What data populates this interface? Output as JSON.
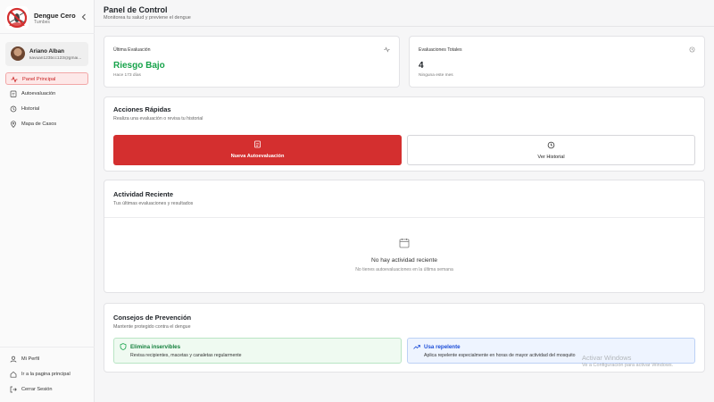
{
  "brand": {
    "title": "Dengue Cero",
    "subtitle": "Tumbes",
    "logo_icon": "no-mosquito-icon",
    "collapse_icon": "chevron-left-icon"
  },
  "user": {
    "name": "Ariano Alban",
    "email": "kavuan123bcc123@gmai..."
  },
  "nav": {
    "items": [
      {
        "label": "Panel Principal",
        "icon": "activity-icon",
        "active": true
      },
      {
        "label": "Autoevaluación",
        "icon": "clipboard-icon",
        "active": false
      },
      {
        "label": "Historial",
        "icon": "history-icon",
        "active": false
      },
      {
        "label": "Mapa de Casos",
        "icon": "map-pin-icon",
        "active": false
      }
    ],
    "bottom": [
      {
        "label": "Mi Perfil",
        "icon": "user-icon"
      },
      {
        "label": "Ir a la pagina principal",
        "icon": "home-icon"
      },
      {
        "label": "Cerrar Sesión",
        "icon": "logout-icon"
      }
    ]
  },
  "header": {
    "title": "Panel de Control",
    "subtitle": "Monitorea tu salud y previene el dengue"
  },
  "stats": {
    "last": {
      "label": "Última Evaluación",
      "value": "Riesgo Bajo",
      "sub": "Hace 173 días",
      "icon": "activity-icon"
    },
    "total": {
      "label": "Evaluaciones Totales",
      "value": "4",
      "sub": "Ninguna este mes",
      "icon": "history-icon"
    }
  },
  "quick": {
    "title": "Acciones Rápidas",
    "subtitle": "Realiza una evaluación o revisa tu historial",
    "new_label": "Nueva Autoevaluación",
    "history_label": "Ver Historial"
  },
  "activity": {
    "title": "Actividad Reciente",
    "subtitle": "Tus últimas evaluaciones y resultados",
    "empty_title": "No hay actividad reciente",
    "empty_sub": "No tienes autoevaluaciones en la última semana"
  },
  "tips": {
    "title": "Consejos de Prevención",
    "subtitle": "Mantente protegido contra el dengue",
    "items": [
      {
        "title": "Elimina inservibles",
        "text": "Revisa recipientes, macetas y canaletas regularmente",
        "icon": "shield-icon"
      },
      {
        "title": "Usa repelente",
        "text": "Aplica repelente especialmente en horas de mayor actividad del mosquito",
        "icon": "trending-up-icon"
      }
    ]
  },
  "watermark": {
    "title": "Activar Windows",
    "subtitle": "Ve a Configuración para activar Windows."
  },
  "colors": {
    "primary": "#d42f2f",
    "success": "#16a34a",
    "info": "#1d4ed8"
  }
}
